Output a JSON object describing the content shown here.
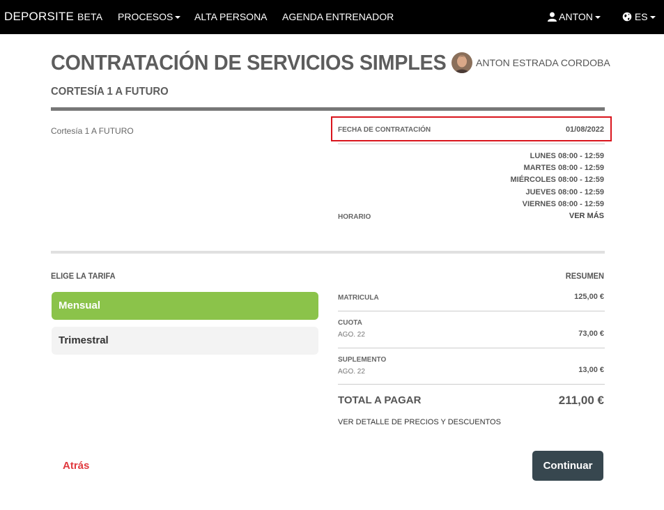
{
  "navbar": {
    "brand": "DEPORSITE",
    "brand_suffix": "BETA",
    "menu": {
      "procesos": "PROCESOS",
      "alta_persona": "ALTA PERSONA",
      "agenda": "AGENDA ENTRENADOR"
    },
    "user_menu_label": "ANTON",
    "language_label": "ES"
  },
  "page": {
    "title": "CONTRATACIÓN DE SERVICIOS SIMPLES",
    "subtitle": "CORTESÍA 1 A FUTURO",
    "user_full_name": "ANTON ESTRADA CORDOBA"
  },
  "service": {
    "description": "Cortesía 1 A FUTURO",
    "fecha_label": "FECHA DE CONTRATACIÓN",
    "fecha_value": "01/08/2022",
    "horario_label": "HORARIO",
    "schedule": [
      "LUNES 08:00 - 12:59",
      "MARTES 08:00 - 12:59",
      "MIÉRCOLES 08:00 - 12:59",
      "JUEVES 08:00 - 12:59",
      "VIERNES 08:00 - 12:59"
    ],
    "ver_mas": "VER MÁS"
  },
  "tarifas": {
    "label": "ELIGE LA TARIFA",
    "options": [
      "Mensual",
      "Trimestral"
    ],
    "selected": "Mensual"
  },
  "resumen": {
    "label": "RESUMEN",
    "matricula_label": "MATRICULA",
    "matricula_value": "125,00 €",
    "cuota_label": "CUOTA",
    "cuota_sub": "AGO. 22",
    "cuota_value": "73,00 €",
    "suplemento_label": "SUPLEMENTO",
    "suplemento_sub": "AGO. 22",
    "suplemento_value": "13,00 €",
    "total_label": "TOTAL A PAGAR",
    "total_value": "211,00 €",
    "detalle_link": "VER DETALLE DE PRECIOS Y DESCUENTOS"
  },
  "actions": {
    "back": "Atrás",
    "continue": "Continuar"
  },
  "colors": {
    "navbar_bg": "#000000",
    "selected_tarifa": "#8bc34a",
    "highlight_border": "#d9141c",
    "continue_bg": "#37474f",
    "back_text": "#e0393e"
  }
}
